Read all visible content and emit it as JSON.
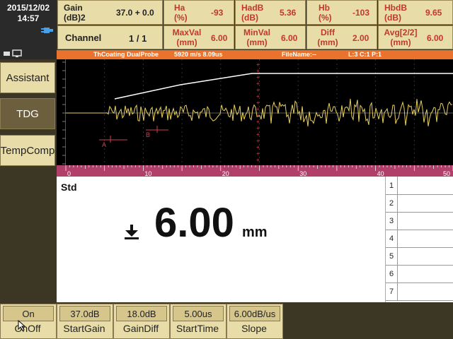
{
  "status": {
    "date": "2015/12/02",
    "time": "14:57"
  },
  "sidebar": {
    "items": [
      {
        "label": "Assistant"
      },
      {
        "label": "TDG"
      },
      {
        "label": "TempComp"
      }
    ]
  },
  "header": {
    "gain_label": "Gain (dB)2",
    "gain_value": "37.0 + 0.0",
    "channel_label": "Channel",
    "channel_value": "1 / 1",
    "ha_label": "Ha (%)",
    "ha_value": "-93",
    "hadb_label": "HadB (dB)",
    "hadb_value": "5.36",
    "hb_label": "Hb (%)",
    "hb_value": "-103",
    "hbdb_label": "HbdB (dB)",
    "hbdb_value": "9.65",
    "maxval_label": "MaxVal (mm)",
    "maxval_value": "6.00",
    "minval_label": "MinVal (mm)",
    "minval_value": "6.00",
    "diff_label": "Diff (mm)",
    "diff_value": "2.00",
    "avg_label": "Avg[2/2] (mm)",
    "avg_value": "6.00"
  },
  "plot": {
    "status_left": "ThCoating DualProbe",
    "status_mid": "5920 m/s  8.09us",
    "status_file": "FileName:--",
    "status_right": "L:3  C:1  P:1",
    "gate_a": "A",
    "gate_b": "B",
    "x_ticks": [
      "0",
      "10",
      "20",
      "30",
      "40",
      "50"
    ],
    "colors": {
      "trace": "#e8d060",
      "gate": "#d04050",
      "tdg": "#ffffff",
      "axis": "#b0406a"
    }
  },
  "result": {
    "mode": "Std",
    "value": "6.00",
    "unit": "mm"
  },
  "table": {
    "rows": [
      "1",
      "2",
      "3",
      "4",
      "5",
      "6",
      "7"
    ]
  },
  "bottom": {
    "buttons": [
      {
        "value": "On",
        "label": "OnOff"
      },
      {
        "value": "37.0dB",
        "label": "StartGain"
      },
      {
        "value": "18.0dB",
        "label": "GainDiff"
      },
      {
        "value": "5.00us",
        "label": "StartTime"
      },
      {
        "value": "6.00dB/us",
        "label": "Slope"
      }
    ]
  }
}
